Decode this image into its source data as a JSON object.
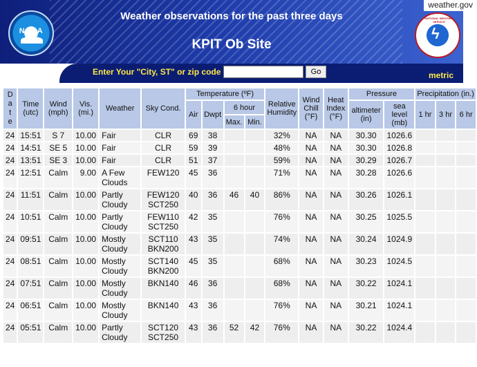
{
  "site": {
    "domain": "weather.gov",
    "header_title": "Weather observations for the past three days",
    "station_title": "KPIT Ob Site",
    "noaa_logo_text": "NOAA",
    "nws_logo_text": "NATIONAL WEATHER SERVICE"
  },
  "search": {
    "label": "Enter Your \"City, ST\" or zip code",
    "value": "",
    "button_label": "Go",
    "metric_link": "metric"
  },
  "table": {
    "headers": {
      "date": [
        "D",
        "a",
        "t",
        "e"
      ],
      "time": "Time (utc)",
      "wind": "Wind (mph)",
      "vis": "Vis. (mi.)",
      "weather": "Weather",
      "sky": "Sky Cond.",
      "temperature": "Temperature (ºF)",
      "air": "Air",
      "dwpt": "Dwpt",
      "six_hour": "6 hour",
      "max": "Max.",
      "min": "Min.",
      "humidity": "Relative Humidity",
      "wind_chill": "Wind Chill (°F)",
      "heat_index": "Heat Index (°F)",
      "pressure": "Pressure",
      "altimeter": "altimeter (in)",
      "sea_level": "sea level (mb)",
      "precipitation": "Precipitation (in.)",
      "p1": "1 hr",
      "p3": "3 hr",
      "p6": "6 hr"
    },
    "rows": [
      {
        "date": "24",
        "time": "15:51",
        "wind": "S 7",
        "vis": "10.00",
        "weather": "Fair",
        "sky": "CLR",
        "air": "69",
        "dwpt": "38",
        "max": "",
        "min": "",
        "humidity": "32%",
        "chill": "NA",
        "heat": "NA",
        "alt": "30.30",
        "sea": "1026.6",
        "p1": "",
        "p3": "",
        "p6": ""
      },
      {
        "date": "24",
        "time": "14:51",
        "wind": "SE 5",
        "vis": "10.00",
        "weather": "Fair",
        "sky": "CLR",
        "air": "59",
        "dwpt": "39",
        "max": "",
        "min": "",
        "humidity": "48%",
        "chill": "NA",
        "heat": "NA",
        "alt": "30.30",
        "sea": "1026.8",
        "p1": "",
        "p3": "",
        "p6": ""
      },
      {
        "date": "24",
        "time": "13:51",
        "wind": "SE 3",
        "vis": "10.00",
        "weather": "Fair",
        "sky": "CLR",
        "air": "51",
        "dwpt": "37",
        "max": "",
        "min": "",
        "humidity": "59%",
        "chill": "NA",
        "heat": "NA",
        "alt": "30.29",
        "sea": "1026.7",
        "p1": "",
        "p3": "",
        "p6": ""
      },
      {
        "date": "24",
        "time": "12:51",
        "wind": "Calm",
        "vis": "9.00",
        "weather": "A Few Clouds",
        "sky": "FEW120",
        "air": "45",
        "dwpt": "36",
        "max": "",
        "min": "",
        "humidity": "71%",
        "chill": "NA",
        "heat": "NA",
        "alt": "30.28",
        "sea": "1026.6",
        "p1": "",
        "p3": "",
        "p6": ""
      },
      {
        "date": "24",
        "time": "11:51",
        "wind": "Calm",
        "vis": "10.00",
        "weather": "Partly Cloudy",
        "sky": "FEW120 SCT250",
        "air": "40",
        "dwpt": "36",
        "max": "46",
        "min": "40",
        "humidity": "86%",
        "chill": "NA",
        "heat": "NA",
        "alt": "30.26",
        "sea": "1026.1",
        "p1": "",
        "p3": "",
        "p6": ""
      },
      {
        "date": "24",
        "time": "10:51",
        "wind": "Calm",
        "vis": "10.00",
        "weather": "Partly Cloudy",
        "sky": "FEW110 SCT250",
        "air": "42",
        "dwpt": "35",
        "max": "",
        "min": "",
        "humidity": "76%",
        "chill": "NA",
        "heat": "NA",
        "alt": "30.25",
        "sea": "1025.5",
        "p1": "",
        "p3": "",
        "p6": ""
      },
      {
        "date": "24",
        "time": "09:51",
        "wind": "Calm",
        "vis": "10.00",
        "weather": "Mostly Cloudy",
        "sky": "SCT110 BKN200",
        "air": "43",
        "dwpt": "35",
        "max": "",
        "min": "",
        "humidity": "74%",
        "chill": "NA",
        "heat": "NA",
        "alt": "30.24",
        "sea": "1024.9",
        "p1": "",
        "p3": "",
        "p6": ""
      },
      {
        "date": "24",
        "time": "08:51",
        "wind": "Calm",
        "vis": "10.00",
        "weather": "Mostly Cloudy",
        "sky": "SCT140 BKN200",
        "air": "45",
        "dwpt": "35",
        "max": "",
        "min": "",
        "humidity": "68%",
        "chill": "NA",
        "heat": "NA",
        "alt": "30.23",
        "sea": "1024.5",
        "p1": "",
        "p3": "",
        "p6": ""
      },
      {
        "date": "24",
        "time": "07:51",
        "wind": "Calm",
        "vis": "10.00",
        "weather": "Mostly Cloudy",
        "sky": "BKN140",
        "air": "46",
        "dwpt": "36",
        "max": "",
        "min": "",
        "humidity": "68%",
        "chill": "NA",
        "heat": "NA",
        "alt": "30.22",
        "sea": "1024.1",
        "p1": "",
        "p3": "",
        "p6": ""
      },
      {
        "date": "24",
        "time": "06:51",
        "wind": "Calm",
        "vis": "10.00",
        "weather": "Mostly Cloudy",
        "sky": "BKN140",
        "air": "43",
        "dwpt": "36",
        "max": "",
        "min": "",
        "humidity": "76%",
        "chill": "NA",
        "heat": "NA",
        "alt": "30.21",
        "sea": "1024.1",
        "p1": "",
        "p3": "",
        "p6": ""
      },
      {
        "date": "24",
        "time": "05:51",
        "wind": "Calm",
        "vis": "10.00",
        "weather": "Partly Cloudy",
        "sky": "SCT120 SCT250",
        "air": "43",
        "dwpt": "36",
        "max": "52",
        "min": "42",
        "humidity": "76%",
        "chill": "NA",
        "heat": "NA",
        "alt": "30.22",
        "sea": "1024.4",
        "p1": "",
        "p3": "",
        "p6": ""
      }
    ]
  }
}
